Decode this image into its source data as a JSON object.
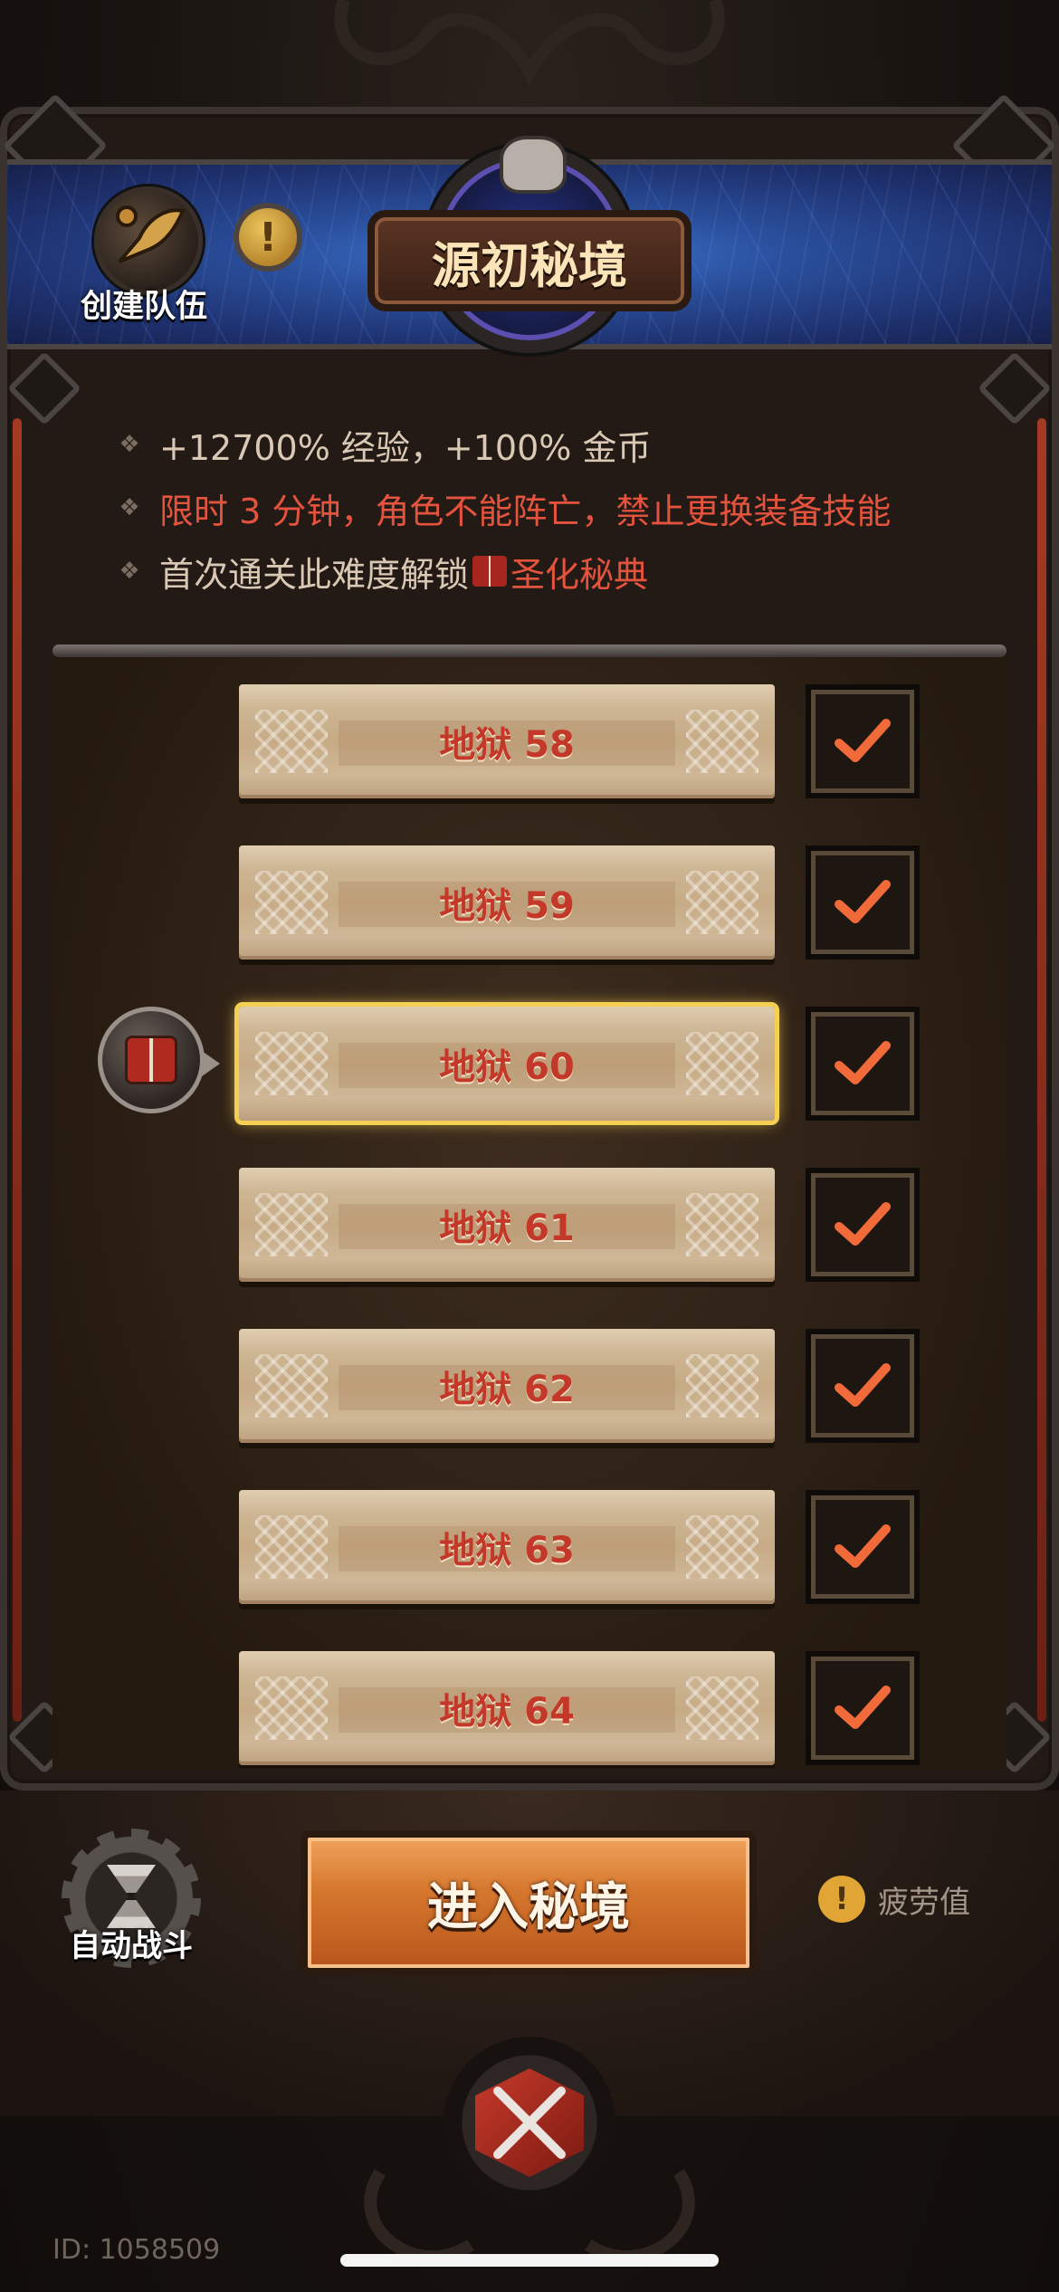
{
  "header": {
    "create_team_label": "创建队伍",
    "title": "源初秘境",
    "info_icon": "exclamation-icon"
  },
  "info": {
    "line1": "+12700% 经验，+100% 金币",
    "line2": "限时 3 分钟，角色不能阵亡，禁止更换装备技能",
    "line3_prefix": "首次通关此难度解锁",
    "line3_item": "圣化秘典",
    "line3_item_icon": "book-icon"
  },
  "levels": [
    {
      "label": "地狱 58",
      "completed": true,
      "selected": false
    },
    {
      "label": "地狱 59",
      "completed": true,
      "selected": false
    },
    {
      "label": "地狱 60",
      "completed": true,
      "selected": true
    },
    {
      "label": "地狱 61",
      "completed": true,
      "selected": false
    },
    {
      "label": "地狱 62",
      "completed": true,
      "selected": false
    },
    {
      "label": "地狱 63",
      "completed": true,
      "selected": false
    },
    {
      "label": "地狱 64",
      "completed": true,
      "selected": false
    }
  ],
  "controls": {
    "auto_battle_label": "自动战斗",
    "enter_label": "进入秘境",
    "fatigue_label": "疲劳值"
  },
  "footer": {
    "user_id": "ID: 1058509"
  },
  "colors": {
    "accent_red": "#e4533d",
    "selected_outline": "#f4cf52",
    "enter_button": "#d6782f"
  }
}
